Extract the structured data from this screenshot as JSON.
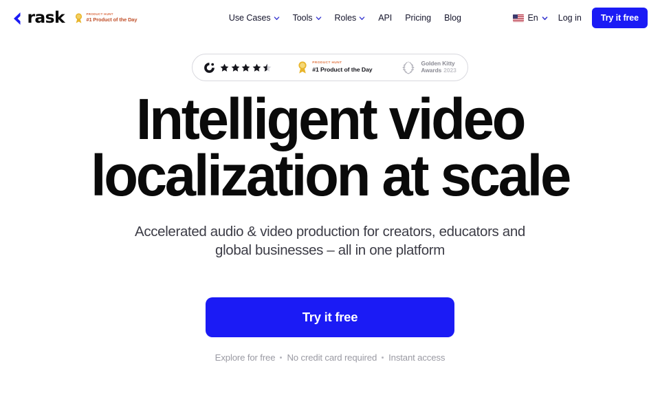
{
  "header": {
    "brand": {
      "logo_word": "rask",
      "logo_mark_icon": "rask-arrow-logo-icon"
    },
    "ph_mini": {
      "eyebrow": "PRODUCT HUNT",
      "title": "#1 Product of the Day",
      "icon": "product-hunt-medal-icon"
    },
    "nav": [
      {
        "label": "Use Cases",
        "has_dropdown": true
      },
      {
        "label": "Tools",
        "has_dropdown": true
      },
      {
        "label": "Roles",
        "has_dropdown": true
      },
      {
        "label": "API",
        "has_dropdown": false
      },
      {
        "label": "Pricing",
        "has_dropdown": false
      },
      {
        "label": "Blog",
        "has_dropdown": false
      }
    ],
    "language": {
      "label": "En",
      "flag_icon": "us-flag-icon",
      "chevron_icon": "chevron-down-icon"
    },
    "login_label": "Log in",
    "cta_label": "Try it free"
  },
  "awards": {
    "g2": {
      "icon": "g2-logo-icon",
      "rating_stars": 4.5,
      "star_count": 5
    },
    "product_hunt": {
      "icon": "product-hunt-medal-icon",
      "eyebrow": "PRODUCT HUNT",
      "title": "#1 Product of the Day"
    },
    "golden_kitty": {
      "icon": "laurel-wreath-icon",
      "line1": "Golden Kitty",
      "line2": "Awards",
      "year": "2023"
    }
  },
  "hero": {
    "headline_line1": "Intelligent video",
    "headline_line2": "localization at scale",
    "subheadline": "Accelerated audio & video production for creators, educators and global businesses – all in one platform",
    "cta_label": "Try it free",
    "fineprint": [
      "Explore for free",
      "No credit card required",
      "Instant access"
    ]
  },
  "colors": {
    "brand_blue": "#1b1bf5",
    "text_dark": "#0a0a0a",
    "text_muted": "#9a9aa3",
    "product_hunt_orange": "#e0733f"
  }
}
